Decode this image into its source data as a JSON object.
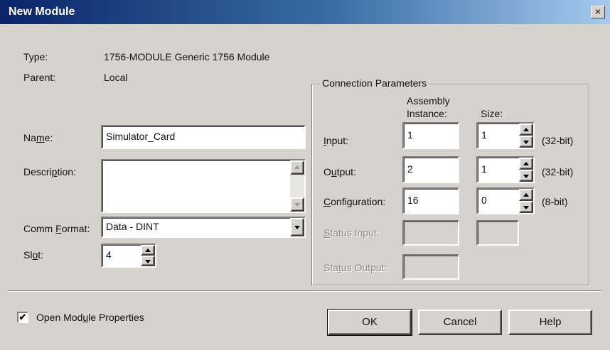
{
  "window": {
    "title": "New Module",
    "close_glyph": "×"
  },
  "module": {
    "type_label": "Type:",
    "type_value": "1756-MODULE Generic 1756 Module",
    "parent_label": "Parent:",
    "parent_value": "Local",
    "name_label": [
      "Na",
      "m",
      "e:"
    ],
    "name_value": "Simulator_Card",
    "description_label": [
      "Descri",
      "p",
      "tion:"
    ],
    "description_value": "",
    "comm_format_label": [
      "Comm ",
      "F",
      "ormat:"
    ],
    "comm_format_value": "Data - DINT",
    "slot_label": [
      "Sl",
      "o",
      "t:"
    ],
    "slot_value": "4"
  },
  "connection": {
    "group_title": "Connection Parameters",
    "col_assembly_line1": "Assembly",
    "col_assembly_line2": "Instance:",
    "col_size": "Size:",
    "input_label": [
      "",
      "I",
      "nput:"
    ],
    "input_instance": "1",
    "input_size": "1",
    "input_unit": "(32-bit)",
    "output_label": [
      "O",
      "u",
      "tput:"
    ],
    "output_instance": "2",
    "output_size": "1",
    "output_unit": "(32-bit)",
    "config_label": [
      "",
      "C",
      "onfiguration:"
    ],
    "config_instance": "16",
    "config_size": "0",
    "config_unit": "(8-bit)",
    "status_input_label": [
      "",
      "S",
      "tatus Input:"
    ],
    "status_output_label": [
      "Sta",
      "t",
      "us Output:"
    ]
  },
  "footer": {
    "open_props_label": [
      "Open Mod",
      "u",
      "le Properties"
    ],
    "open_props_checked": "✔",
    "ok_label": "OK",
    "cancel_label": "Cancel",
    "help_label": "Help"
  },
  "colors": {
    "title_start": "#0a246a",
    "title_end": "#a6caf0",
    "face": "#d6d3ce"
  }
}
